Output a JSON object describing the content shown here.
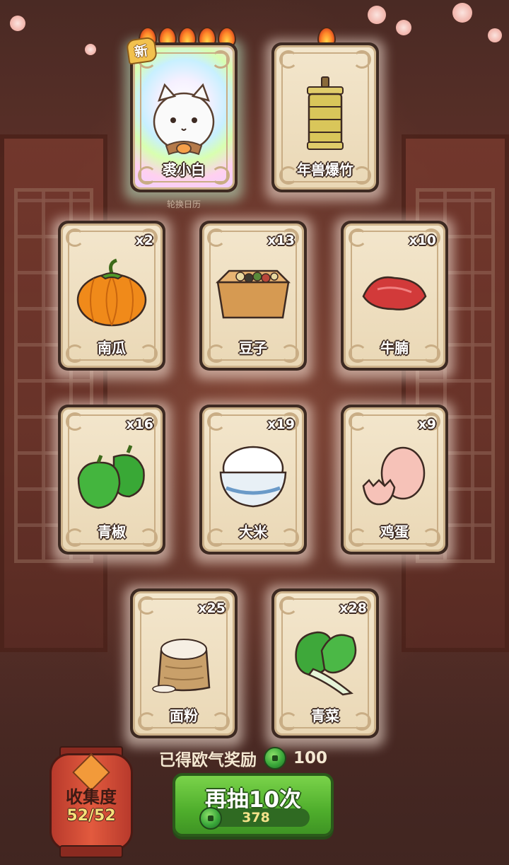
{
  "featured_cards": [
    {
      "label": "裘小白",
      "badge": "新",
      "flames": 5,
      "art": "white-cat-icon"
    },
    {
      "label": "年兽爆竹",
      "flames": 1,
      "art": "firecracker-icon"
    }
  ],
  "subtitle": "轮换日历",
  "items": [
    {
      "label": "南瓜",
      "count": "x2",
      "art": "pumpkin-icon"
    },
    {
      "label": "豆子",
      "count": "x13",
      "art": "beans-box-icon"
    },
    {
      "label": "牛腩",
      "count": "x10",
      "art": "beef-icon"
    },
    {
      "label": "青椒",
      "count": "x16",
      "art": "green-pepper-icon"
    },
    {
      "label": "大米",
      "count": "x19",
      "art": "rice-bowl-icon"
    },
    {
      "label": "鸡蛋",
      "count": "x9",
      "art": "egg-icon"
    },
    {
      "label": "面粉",
      "count": "x25",
      "art": "flour-sack-icon"
    },
    {
      "label": "青菜",
      "count": "x28",
      "art": "bok-choy-icon"
    }
  ],
  "reward": {
    "label": "已得欧气奖励",
    "value": "100"
  },
  "collection": {
    "title": "收集度",
    "value": "52/52"
  },
  "draw_button": {
    "label": "再抽10次",
    "cost": "378"
  }
}
